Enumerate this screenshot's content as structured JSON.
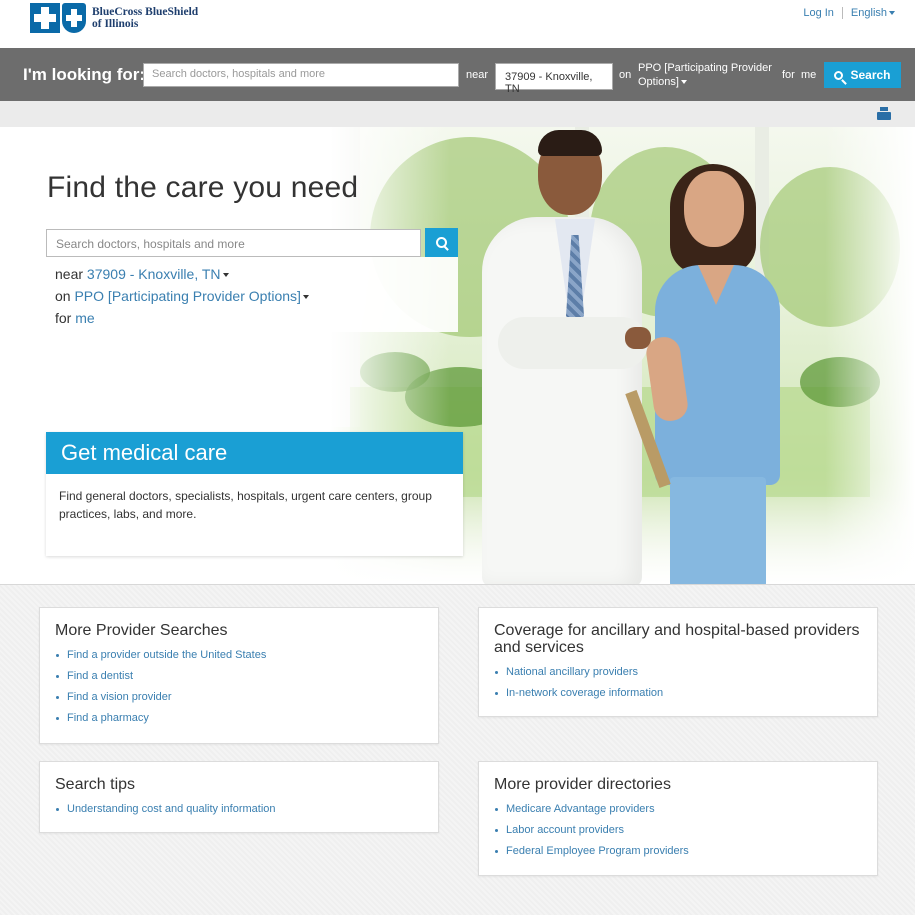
{
  "header": {
    "logo_line1": "BlueCross BlueShield",
    "logo_line2": "of Illinois",
    "login": "Log In",
    "language": "English"
  },
  "searchbar": {
    "label": "I'm looking for:",
    "placeholder": "Search doctors, hospitals and more",
    "near": "near",
    "zip": "37909 - Knoxville, TN",
    "on": "on",
    "plan": "PPO [Participating Provider Options]",
    "for": "for",
    "me": "me",
    "button": "Search"
  },
  "hero": {
    "title": "Find the care you need",
    "placeholder": "Search doctors, hospitals and more",
    "near_label": "near",
    "location": "37909 - Knoxville, TN",
    "on_label": "on",
    "plan": "PPO [Participating Provider Options]",
    "for_label": "for",
    "for_value": "me"
  },
  "care_card": {
    "title": "Get medical care",
    "body": "Find general doctors, specialists, hospitals, urgent care centers, group practices, labs, and more."
  },
  "panels": {
    "more_searches": {
      "title": "More Provider Searches",
      "links": [
        "Find a provider outside the United States",
        "Find a dentist",
        "Find a vision provider",
        "Find a pharmacy"
      ]
    },
    "coverage": {
      "title": "Coverage for ancillary and hospital-based providers and services",
      "links": [
        "National ancillary providers",
        "In-network coverage information"
      ]
    },
    "search_tips": {
      "title": "Search tips",
      "links": [
        "Understanding cost and quality information"
      ]
    },
    "directories": {
      "title": "More provider directories",
      "links": [
        "Medicare Advantage providers",
        "Labor account providers",
        "Federal Employee Program providers"
      ]
    }
  },
  "colors": {
    "accent": "#1a9fd4",
    "search_bar_bg": "#6d6d6d",
    "link": "#3a7fb0",
    "brand": "#0a6aa8"
  },
  "icons": [
    "bcbs-cross-logo-icon",
    "bcbs-shield-logo-icon",
    "search-icon",
    "print-icon",
    "chevron-down-icon"
  ]
}
